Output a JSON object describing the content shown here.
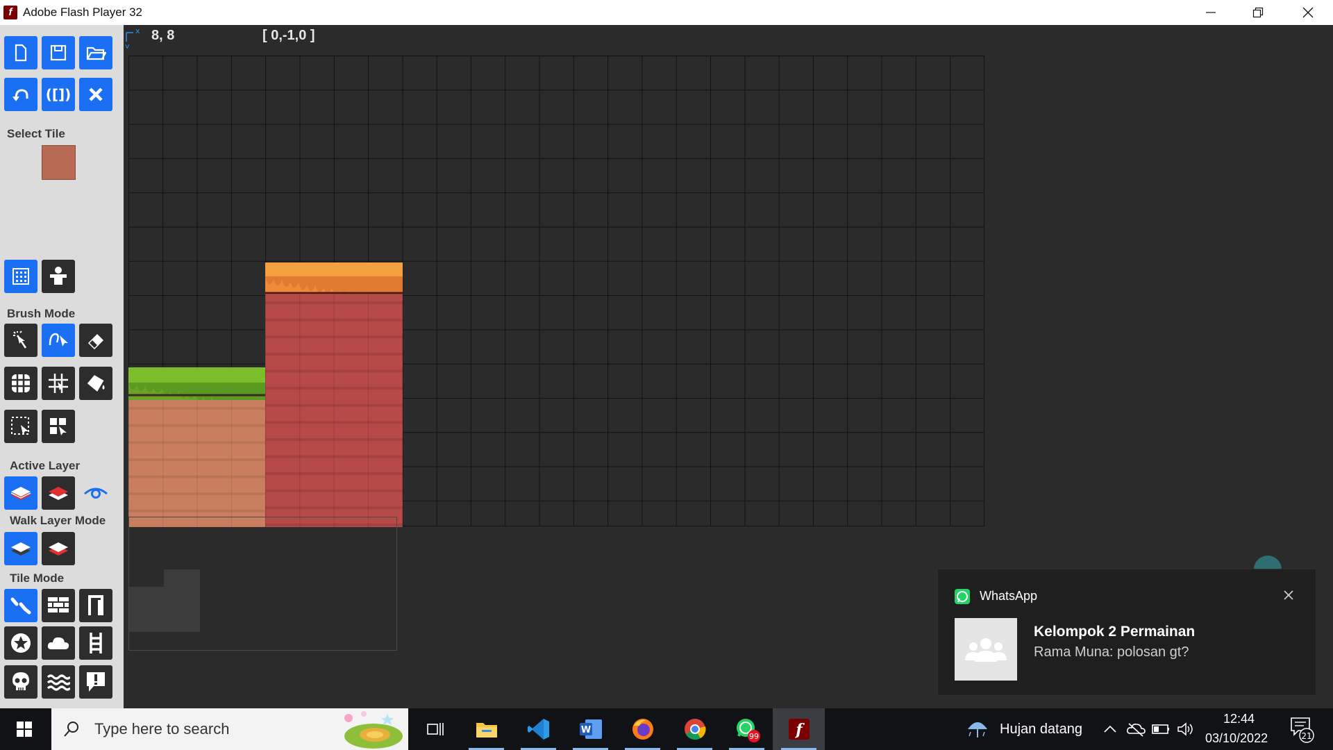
{
  "window": {
    "title": "Adobe Flash Player 32",
    "app_icon": "flash-f-icon",
    "controls": [
      "minimize-icon",
      "restore-icon",
      "close-icon"
    ]
  },
  "toolbar": {
    "file_buttons": [
      "new-file-icon",
      "save-icon",
      "open-folder-icon"
    ],
    "edit_buttons": [
      "undo-icon",
      "brackets-icon",
      "clear-x-icon"
    ],
    "select_tile_label": "Select Tile",
    "selected_tile_color": "#b86a52",
    "view_buttons": [
      "tile-grid-icon",
      "character-icon"
    ],
    "brush_mode_label": "Brush Mode",
    "brush_buttons": [
      "magic-wand-icon",
      "brush-pick-icon",
      "eraser-icon",
      "fill-grid-icon",
      "grid-lines-icon",
      "paint-bucket-icon",
      "select-rect-icon",
      "stamp-select-icon"
    ],
    "active_layer_label": "Active Layer",
    "layer_buttons": [
      "layer-front-icon",
      "layer-back-icon",
      "eye-icon"
    ],
    "walk_layer_mode_label": "Walk Layer Mode",
    "walk_buttons": [
      "walk-layer-on-icon",
      "walk-layer-off-icon"
    ],
    "tile_mode_label": "Tile Mode",
    "tile_mode_buttons": [
      "slope-icon",
      "brick-wall-icon",
      "door-frame-icon",
      "star-coin-icon",
      "cloud-icon",
      "ladder-icon",
      "skull-icon",
      "water-waves-icon",
      "alert-sign-icon"
    ]
  },
  "canvas": {
    "cursor_coords": "8, 8",
    "cell_index": "[ 0,-1,0 ]",
    "axis_labels": {
      "x": "x",
      "y": "y"
    }
  },
  "notification": {
    "app_name": "WhatsApp",
    "title": "Kelompok 2 Permainan",
    "message": "Rama Muna: polosan gt?"
  },
  "taskbar": {
    "search_placeholder": "Type here to search",
    "apps": [
      "task-view-icon",
      "file-explorer-icon",
      "vscode-icon",
      "word-icon",
      "firefox-icon",
      "chrome-icon",
      "whatsapp-icon",
      "flash-player-icon"
    ],
    "whatsapp_badge": "99",
    "weather": "Hujan datang",
    "time": "12:44",
    "date": "03/10/2022",
    "notifications_count": "21"
  },
  "colors": {
    "accent_blue": "#1a6ff2",
    "grass": "#6aa325",
    "dirt": "#c97e60",
    "red_rock": "#b64a48",
    "orange_top": "#f08a3a"
  }
}
